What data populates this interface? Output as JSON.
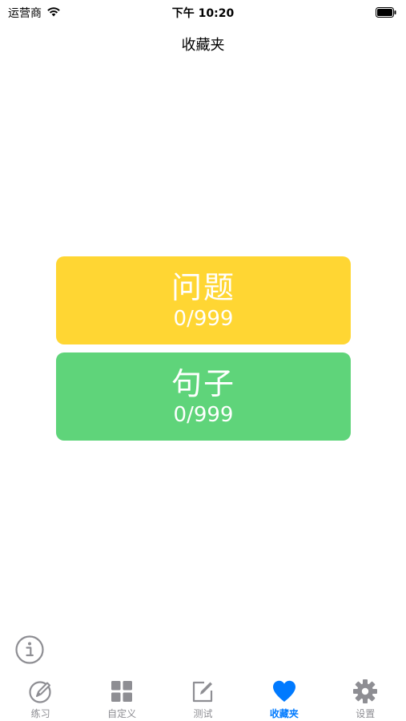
{
  "status_bar": {
    "carrier": "运营商",
    "time": "下午 10:20"
  },
  "nav": {
    "title": "收藏夹"
  },
  "cards": [
    {
      "title": "问题",
      "count": "0/999",
      "color": "#FFD633"
    },
    {
      "title": "句子",
      "count": "0/999",
      "color": "#5FD47A"
    }
  ],
  "tabs": [
    {
      "label": "练习",
      "icon": "pencil-circle-icon",
      "active": false
    },
    {
      "label": "自定义",
      "icon": "grid-icon",
      "active": false
    },
    {
      "label": "测试",
      "icon": "edit-square-icon",
      "active": false
    },
    {
      "label": "收藏夹",
      "icon": "heart-icon",
      "active": true
    },
    {
      "label": "设置",
      "icon": "gear-icon",
      "active": false
    }
  ],
  "colors": {
    "accent": "#007AFF",
    "inactive": "#8E8E93"
  }
}
